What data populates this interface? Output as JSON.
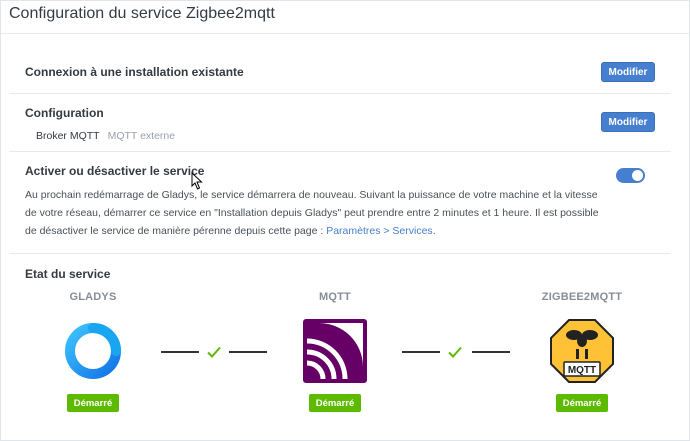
{
  "page": {
    "title": "Configuration du service Zigbee2mqtt"
  },
  "connexion": {
    "title": "Connexion à une installation existante",
    "button": "Modifier"
  },
  "configuration": {
    "title": "Configuration",
    "button": "Modifier",
    "broker_label": "Broker MQTT",
    "broker_value": "MQTT externe"
  },
  "activation": {
    "title": "Activer ou désactiver le service",
    "toggle_state": "on",
    "description": "Au prochain redémarrage de Gladys, le service démarrera de nouveau. Suivant la puissance de votre machine et la vitesse de votre réseau, démarrer ce service en \"Installation depuis Gladys\" peut prendre entre 2 minutes et 1 heure. Il est possible de désactiver le service de manière pérenne depuis cette page : ",
    "link": "Paramètres > Services",
    "description_end": "."
  },
  "status": {
    "title": "Etat du service",
    "services": [
      {
        "name": "GLADYS",
        "badge": "Démarré",
        "icon": "gladys-logo-icon"
      },
      {
        "name": "MQTT",
        "badge": "Démarré",
        "icon": "mqtt-logo-icon"
      },
      {
        "name": "ZIGBEE2MQTT",
        "badge": "Démarré",
        "icon": "zigbee2mqtt-logo-icon"
      }
    ],
    "colors": {
      "badge": "#5eba00",
      "check": "#5eba00",
      "mqtt": "#660066",
      "zigbee": "#ffc135"
    }
  },
  "colors": {
    "primary": "#467fcf"
  }
}
